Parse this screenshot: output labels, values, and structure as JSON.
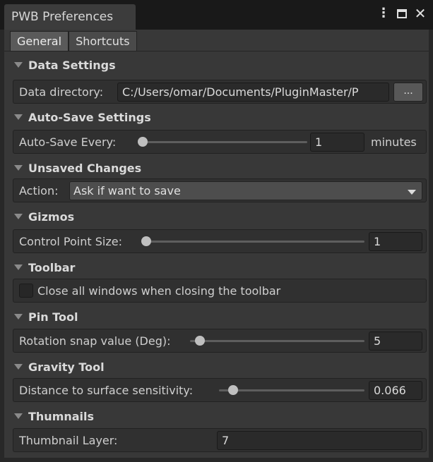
{
  "window": {
    "title": "PWB Preferences"
  },
  "tabs": [
    {
      "label": "General",
      "active": true
    },
    {
      "label": "Shortcuts",
      "active": false
    }
  ],
  "sections": {
    "data": {
      "title": "Data Settings",
      "directory_label": "Data directory:",
      "directory_value": "C:/Users/omar/Documents/PluginMaster/P",
      "browse_label": "..."
    },
    "autosave": {
      "title": "Auto-Save Settings",
      "label": "Auto-Save Every:",
      "value": "1",
      "unit": "minutes",
      "slider_fraction": 0.0
    },
    "unsaved": {
      "title": "Unsaved Changes",
      "label": "Action:",
      "selected": "Ask if want to save"
    },
    "gizmos": {
      "title": "Gizmos",
      "label": "Control Point Size:",
      "value": "1",
      "slider_fraction": 0.0
    },
    "toolbar": {
      "title": "Toolbar",
      "checkbox_label": "Close all windows when closing the toolbar",
      "checked": false
    },
    "pin": {
      "title": "Pin Tool",
      "label": "Rotation snap value (Deg):",
      "value": "5",
      "slider_fraction": 0.03
    },
    "gravity": {
      "title": "Gravity Tool",
      "label": "Distance to surface sensitivity:",
      "value": "0.066",
      "slider_fraction": 0.07
    },
    "thumbnails": {
      "title": "Thumnails",
      "label": "Thumbnail Layer:",
      "value": "7"
    }
  }
}
